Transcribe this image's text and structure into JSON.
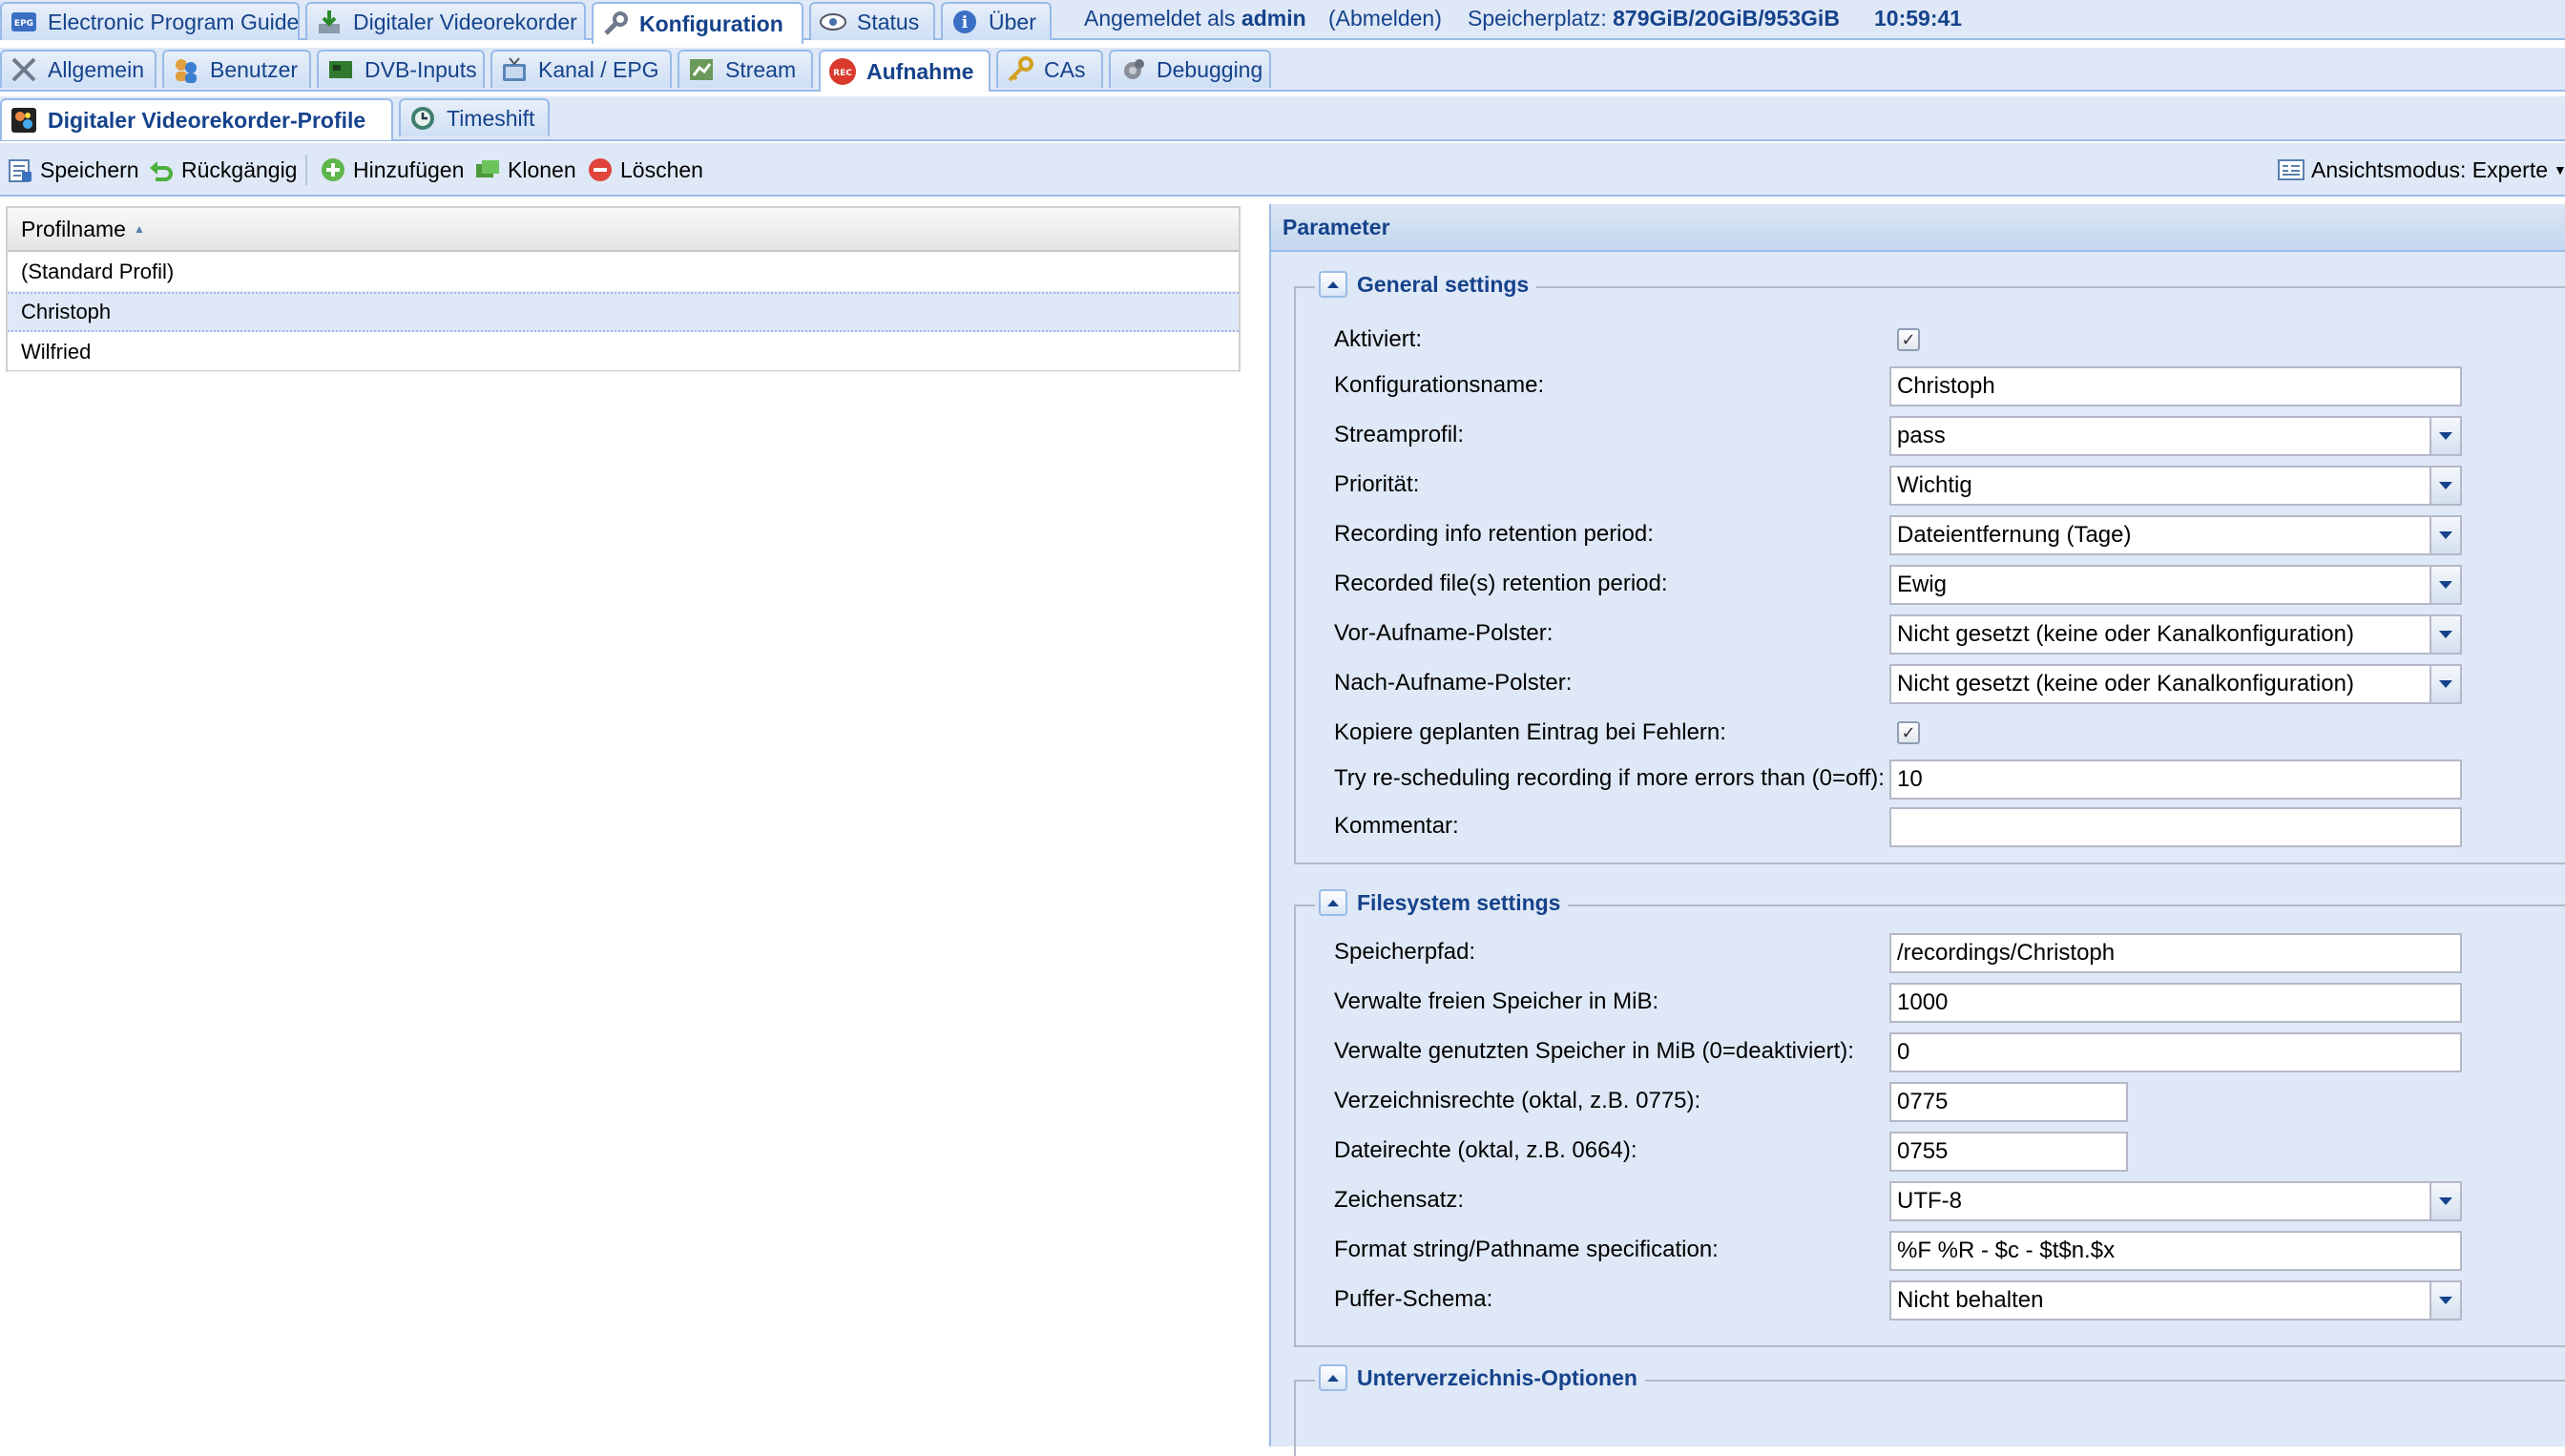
{
  "main_tabs": [
    {
      "label": "Electronic Program Guide",
      "icon": "epg-icon"
    },
    {
      "label": "Digitaler Videorekorder",
      "icon": "download-icon"
    },
    {
      "label": "Konfiguration",
      "icon": "wrench-icon"
    },
    {
      "label": "Status",
      "icon": "eye-icon"
    },
    {
      "label": "Über",
      "icon": "info-icon"
    }
  ],
  "session": {
    "logged_in_prefix": "Angemeldet als",
    "user": "admin",
    "logout": "(Abmelden)",
    "storage_label": "Speicherplatz:",
    "storage_value": "879GiB/20GiB/953GiB",
    "time": "10:59:41"
  },
  "config_tabs": [
    {
      "label": "Allgemein",
      "icon": "tools-icon"
    },
    {
      "label": "Benutzer",
      "icon": "users-icon"
    },
    {
      "label": "DVB-Inputs",
      "icon": "card-icon"
    },
    {
      "label": "Kanal / EPG",
      "icon": "tv-icon"
    },
    {
      "label": "Stream",
      "icon": "stream-icon"
    },
    {
      "label": "Aufnahme",
      "icon": "rec-icon"
    },
    {
      "label": "CAs",
      "icon": "key-icon"
    },
    {
      "label": "Debugging",
      "icon": "bug-icon"
    }
  ],
  "sub_tabs": [
    {
      "label": "Digitaler Videorekorder-Profile",
      "icon": "dvr-icon"
    },
    {
      "label": "Timeshift",
      "icon": "clock-icon"
    }
  ],
  "toolbar": {
    "save": "Speichern",
    "undo": "Rückgängig",
    "add": "Hinzufügen",
    "clone": "Klonen",
    "delete": "Löschen",
    "view_mode": "Ansichtsmodus: Experte"
  },
  "grid": {
    "column": "Profilname",
    "rows": [
      "(Standard Profil)",
      "Christoph",
      "Wilfried"
    ],
    "selected": "Christoph"
  },
  "panel": {
    "title": "Parameter",
    "general": {
      "title": "General settings",
      "enabled_label": "Aktiviert:",
      "enabled": true,
      "config_name_label": "Konfigurationsname:",
      "config_name": "Christoph",
      "stream_profile_label": "Streamprofil:",
      "stream_profile": "pass",
      "priority_label": "Priorität:",
      "priority": "Wichtig",
      "info_retention_label": "Recording info retention period:",
      "info_retention": "Dateientfernung (Tage)",
      "file_retention_label": "Recorded file(s) retention period:",
      "file_retention": "Ewig",
      "pre_padding_label": "Vor-Aufname-Polster:",
      "pre_padding": "Nicht gesetzt (keine oder Kanalkonfiguration)",
      "post_padding_label": "Nach-Aufname-Polster:",
      "post_padding": "Nicht gesetzt (keine oder Kanalkonfiguration)",
      "clone_on_error_label": "Kopiere geplanten Eintrag bei Fehlern:",
      "clone_on_error": true,
      "reschedule_label": "Try re-scheduling recording if more errors than (0=off):",
      "reschedule": "10",
      "comment_label": "Kommentar:",
      "comment": ""
    },
    "filesystem": {
      "title": "Filesystem settings",
      "path_label": "Speicherpfad:",
      "path": "/recordings/Christoph",
      "free_space_label": "Verwalte freien Speicher in MiB:",
      "free_space": "1000",
      "used_space_label": "Verwalte genutzten Speicher in MiB (0=deaktiviert):",
      "used_space": "0",
      "dir_perms_label": "Verzeichnisrechte (oktal, z.B. 0775):",
      "dir_perms": "0775",
      "file_perms_label": "Dateirechte (oktal, z.B. 0664):",
      "file_perms": "0755",
      "charset_label": "Zeichensatz:",
      "charset": "UTF-8",
      "format_label": "Format string/Pathname specification:",
      "format": "%F %R - $c - $t$n.$x",
      "cache_label": "Puffer-Schema:",
      "cache": "Nicht behalten"
    },
    "subdir": {
      "title": "Unterverzeichnis-Optionen"
    }
  }
}
